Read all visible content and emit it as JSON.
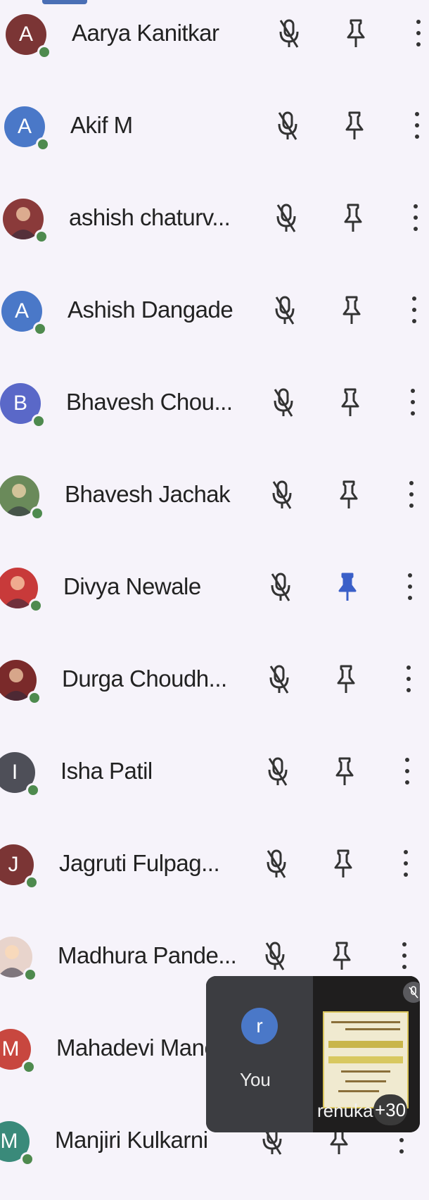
{
  "participants": [
    {
      "name": "Aarya Kanitkar",
      "initial": "A",
      "avatar_color": "#7b3535",
      "photo": false,
      "pinned": false
    },
    {
      "name": "Akif M",
      "initial": "A",
      "avatar_color": "#4a78c8",
      "photo": false,
      "pinned": false
    },
    {
      "name": "ashish chaturv...",
      "initial": "",
      "avatar_color": "#8a3a3a",
      "photo": true,
      "pinned": false
    },
    {
      "name": "Ashish Dangade",
      "initial": "A",
      "avatar_color": "#4a78c8",
      "photo": false,
      "pinned": false
    },
    {
      "name": "Bhavesh Chou...",
      "initial": "B",
      "avatar_color": "#5a68c8",
      "photo": false,
      "pinned": false
    },
    {
      "name": "Bhavesh Jachak",
      "initial": "",
      "avatar_color": "#6a8a5a",
      "photo": true,
      "pinned": false
    },
    {
      "name": "Divya Newale",
      "initial": "",
      "avatar_color": "#c83a3a",
      "photo": true,
      "pinned": true
    },
    {
      "name": "Durga Choudh...",
      "initial": "",
      "avatar_color": "#7a2a2a",
      "photo": true,
      "pinned": false
    },
    {
      "name": "Isha Patil",
      "initial": "I",
      "avatar_color": "#4e4f58",
      "photo": false,
      "pinned": false
    },
    {
      "name": "Jagruti Fulpag...",
      "initial": "J",
      "avatar_color": "#7b3535",
      "photo": false,
      "pinned": false
    },
    {
      "name": "Madhura Pande...",
      "initial": "",
      "avatar_color": "#e8d4cc",
      "photo": true,
      "pinned": false
    },
    {
      "name": "Mahadevi Mane",
      "initial": "M",
      "avatar_color": "#c8473f",
      "photo": false,
      "pinned": false
    },
    {
      "name": "Manjiri Kulkarni",
      "initial": "M",
      "avatar_color": "#3a8a7a",
      "photo": false,
      "pinned": false
    }
  ],
  "self_view": {
    "initial": "r",
    "label": "You"
  },
  "presenter": {
    "name": "renuka",
    "overflow_count": "+30"
  },
  "colors": {
    "pinned": "#3a5fc8",
    "icon": "#333333",
    "online": "#4e8a4e"
  }
}
